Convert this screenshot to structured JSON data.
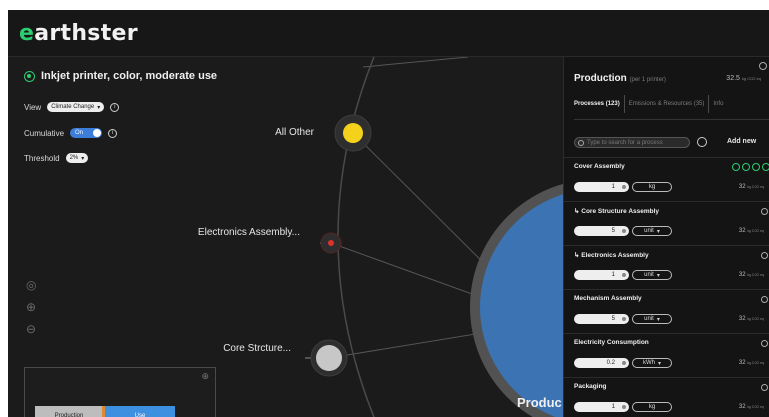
{
  "app": {
    "logo": "earthster",
    "logo_e": "e",
    "logo_rest": "arthster"
  },
  "controls": {
    "title": "Inkjet printer, color, moderate use",
    "view_label": "View",
    "view_value": "Climate Change",
    "cumulative_label": "Cumulative",
    "cumulative_value": "On",
    "threshold_label": "Threshold",
    "threshold_value": "2%"
  },
  "nodes": [
    {
      "label": "All Other",
      "color": "#f4d21b"
    },
    {
      "label": "Electronics Assembly...",
      "color": "#e0322c"
    },
    {
      "label": "Core Strcture...",
      "color": "#c7c7c7"
    },
    {
      "label": "Produc",
      "color": "#3b73b3"
    }
  ],
  "minimap": {
    "left": "Production",
    "right": "Use"
  },
  "panel": {
    "title": "Production",
    "subtitle": "(per 1 printer)",
    "value": "32.5",
    "value_unit": "kg CO2 eq",
    "tabs": [
      "Processes (123)",
      "Emissions & Resources (35)",
      "Info"
    ],
    "search_placeholder": "Type to search for a process",
    "add_new": "Add new",
    "processes": [
      {
        "name": "Cover Assembly",
        "qty": "1",
        "unit": "kg",
        "value": "32",
        "value_unit": "kg CO2 eq",
        "selectable": false
      },
      {
        "name": "Core Structure Assembly",
        "qty": "5",
        "unit": "unit",
        "value": "32",
        "value_unit": "kg CO2 eq",
        "selectable": true
      },
      {
        "name": "Electronics Assembly",
        "qty": "1",
        "unit": "unit",
        "value": "32",
        "value_unit": "kg CO2 eq",
        "selectable": true
      },
      {
        "name": "Mechanism Assembly",
        "qty": "5",
        "unit": "unit",
        "value": "32",
        "value_unit": "kg CO2 eq",
        "selectable": true
      },
      {
        "name": "Electricity Consumption",
        "qty": "0.2",
        "unit": "kWh",
        "value": "32",
        "value_unit": "kg CO2 eq",
        "selectable": true
      },
      {
        "name": "Packaging",
        "qty": "1",
        "unit": "kg",
        "value": "32",
        "value_unit": "kg CO2 eq",
        "selectable": false
      }
    ]
  },
  "colors": {
    "accent": "#2ecc71",
    "toggle": "#3b7dd8",
    "background": "#1b1b1b"
  }
}
